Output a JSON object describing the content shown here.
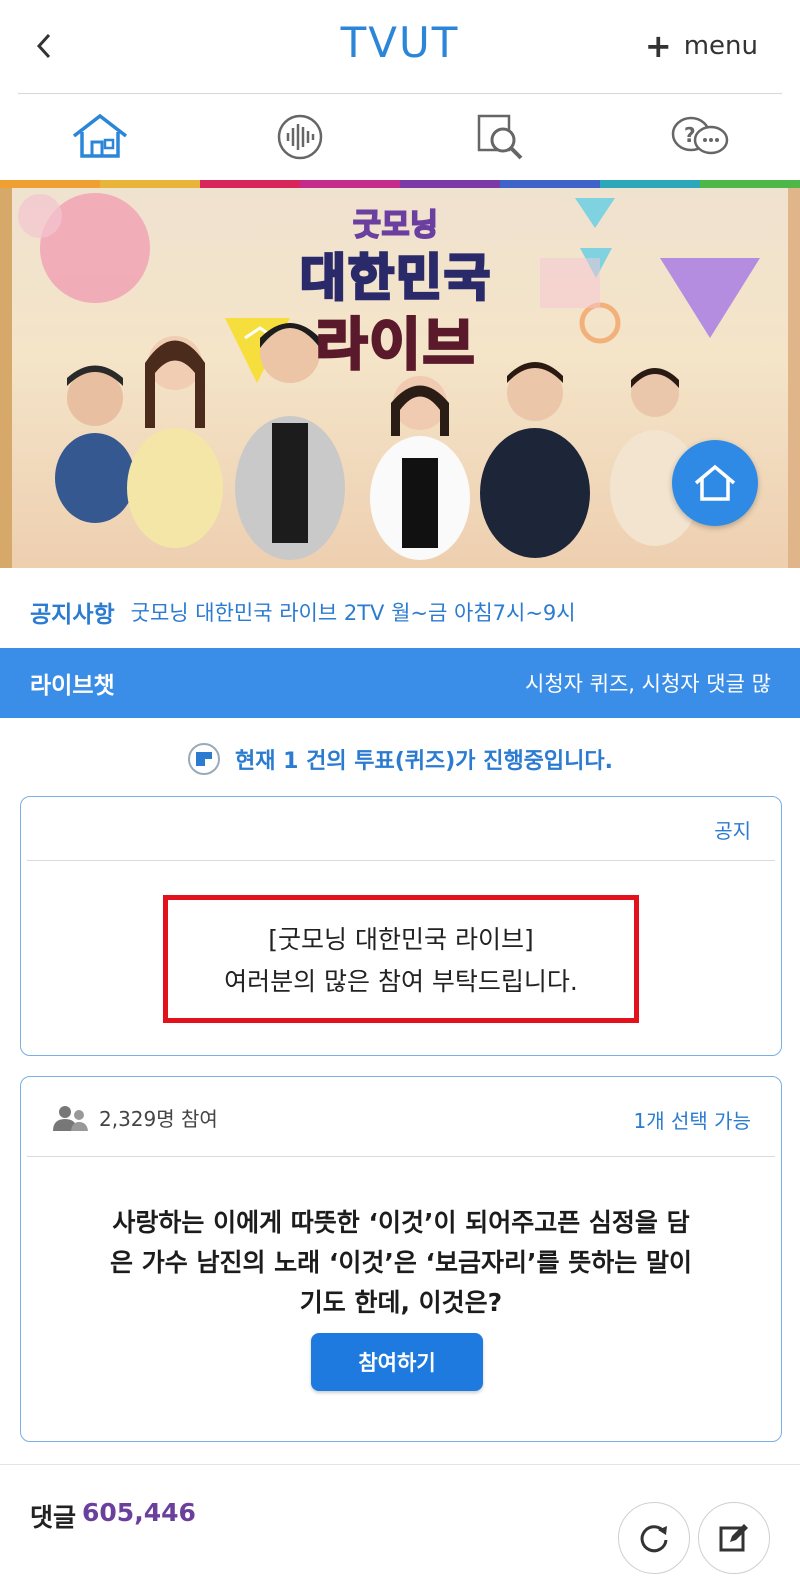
{
  "header": {
    "logo": "TVUT",
    "menu_label": "menu"
  },
  "nav": {
    "items": [
      "home-icon",
      "audio-icon",
      "search-icon",
      "faq-chat-icon"
    ]
  },
  "rainbow_colors": [
    "#f0a030",
    "#e8b43a",
    "#d8255a",
    "#c42b8a",
    "#7c3aa8",
    "#3f63c8",
    "#2aa7b8",
    "#4db848"
  ],
  "banner": {
    "logo_small": "굿모닝",
    "logo_mid": "대한민국",
    "logo_big": "라이브"
  },
  "notice": {
    "label": "공지사항",
    "text": "굿모닝 대한민국 라이브 2TV 월~금 아침7시~9시"
  },
  "livechat": {
    "title": "라이브챗",
    "marquee": "시청자 퀴즈, 시청자 댓글 많"
  },
  "vote_status": "현재 1 건의 투표(퀴즈)가 진행중입니다.",
  "card_notice": {
    "tag": "공지",
    "line1": "[굿모닝 대한민국 라이브]",
    "line2": "여러분의 많은 참여 부탁드립니다."
  },
  "quiz": {
    "participants": "2,329명 참여",
    "select_rule": "1개 선택 가능",
    "question_line1": "사랑하는 이에게 따뜻한 ‘이것’이 되어주고픈 심정을 담",
    "question_line2": "은 가수 남진의 노래 ‘이것’은 ‘보금자리’를 뜻하는 말이",
    "question_line3": "기도 한데, 이것은?",
    "join_label": "참여하기"
  },
  "comments": {
    "label": "댓글",
    "count": "605,446"
  }
}
